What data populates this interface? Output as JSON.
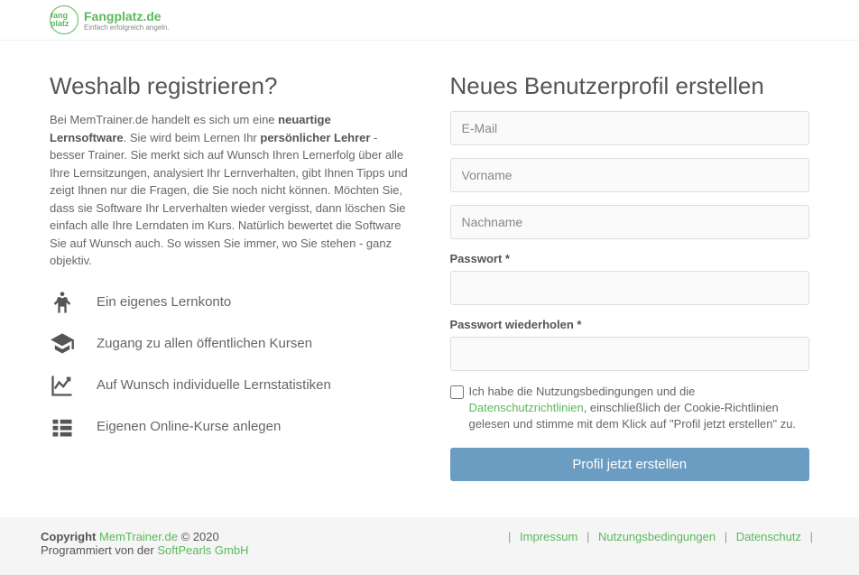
{
  "header": {
    "logo_circle": "fang platz",
    "logo_name": "Fangplatz.de",
    "logo_tag": "Einfach erfolgreich angeln."
  },
  "left": {
    "heading": "Weshalb registrieren?",
    "intro_1": "Bei MemTrainer.de handelt es sich um eine ",
    "intro_bold1": "neuartige Lernsoftware",
    "intro_2": ". Sie wird beim Lernen Ihr ",
    "intro_bold2": "persönlicher Lehrer",
    "intro_3": " - besser Trainer. Sie merkt sich auf Wunsch Ihren Lernerfolg über alle Ihre Lernsitzungen, analysiert Ihr Lernverhalten, gibt Ihnen Tipps und zeigt Ihnen nur die Fragen, die Sie noch nicht können. Möchten Sie, dass sie Software Ihr Lerverhalten wieder vergisst, dann löschen Sie einfach alle Ihre Lerndaten im Kurs. Natürlich bewertet die Software Sie auf Wunsch auch. So wissen Sie immer, wo Sie stehen - ganz objektiv.",
    "features": [
      "Ein eigenes Lernkonto",
      "Zugang zu allen öffentlichen Kursen",
      "Auf Wunsch individuelle Lernstatistiken",
      "Eigenen Online-Kurse anlegen"
    ]
  },
  "right": {
    "heading": "Neues Benutzerprofil erstellen",
    "email_ph": "E-Mail",
    "vorname_ph": "Vorname",
    "nachname_ph": "Nachname",
    "pw_label": "Passwort *",
    "pw2_label": "Passwort wiederholen *",
    "terms_1": "Ich habe die Nutzungsbedingungen und die ",
    "terms_link": "Datenschutzrichtlinien",
    "terms_2": ", einschließlich der Cookie-Richtlinien gelesen und stimme mit dem Klick auf \"Profil jetzt erstellen\" zu.",
    "submit": "Profil jetzt erstellen"
  },
  "footer": {
    "copyright": "Copyright",
    "site_link": "MemTrainer.de",
    "year": " © 2020",
    "prog": "Programmiert von der ",
    "prog_link": "SoftPearls GmbH",
    "impressum": "Impressum",
    "nutzungs": "Nutzungsbedingungen",
    "datenschutz": "Datenschutz"
  }
}
